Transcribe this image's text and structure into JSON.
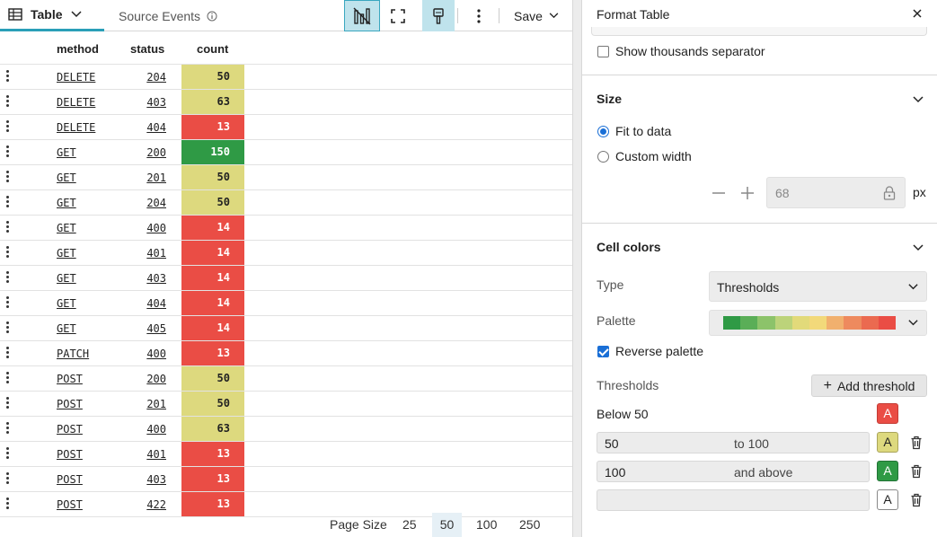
{
  "toolbar": {
    "tab_table": "Table",
    "tab_source": "Source Events",
    "save_label": "Save"
  },
  "table": {
    "columns": [
      "method",
      "status",
      "count"
    ],
    "rows": [
      {
        "method": "DELETE",
        "status": "204",
        "count": "50",
        "color": "yellow"
      },
      {
        "method": "DELETE",
        "status": "403",
        "count": "63",
        "color": "yellow"
      },
      {
        "method": "DELETE",
        "status": "404",
        "count": "13",
        "color": "red"
      },
      {
        "method": "GET",
        "status": "200",
        "count": "150",
        "color": "green"
      },
      {
        "method": "GET",
        "status": "201",
        "count": "50",
        "color": "yellow"
      },
      {
        "method": "GET",
        "status": "204",
        "count": "50",
        "color": "yellow"
      },
      {
        "method": "GET",
        "status": "400",
        "count": "14",
        "color": "red"
      },
      {
        "method": "GET",
        "status": "401",
        "count": "14",
        "color": "red"
      },
      {
        "method": "GET",
        "status": "403",
        "count": "14",
        "color": "red"
      },
      {
        "method": "GET",
        "status": "404",
        "count": "14",
        "color": "red"
      },
      {
        "method": "GET",
        "status": "405",
        "count": "14",
        "color": "red"
      },
      {
        "method": "PATCH",
        "status": "400",
        "count": "13",
        "color": "red"
      },
      {
        "method": "POST",
        "status": "200",
        "count": "50",
        "color": "yellow"
      },
      {
        "method": "POST",
        "status": "201",
        "count": "50",
        "color": "yellow"
      },
      {
        "method": "POST",
        "status": "400",
        "count": "63",
        "color": "yellow"
      },
      {
        "method": "POST",
        "status": "401",
        "count": "13",
        "color": "red"
      },
      {
        "method": "POST",
        "status": "403",
        "count": "13",
        "color": "red"
      },
      {
        "method": "POST",
        "status": "422",
        "count": "13",
        "color": "red"
      }
    ]
  },
  "pager": {
    "label": "Page Size",
    "options": [
      "25",
      "50",
      "100",
      "250"
    ],
    "selected": "50"
  },
  "panel": {
    "title": "Format Table",
    "thousands_label": "Show thousands separator",
    "thousands_checked": false,
    "size": {
      "title": "Size",
      "fit_label": "Fit to data",
      "custom_label": "Custom width",
      "selected": "fit",
      "width_placeholder": "68",
      "unit": "px"
    },
    "cell_colors": {
      "title": "Cell colors",
      "type_label": "Type",
      "type_value": "Thresholds",
      "palette_label": "Palette",
      "palette_colors": [
        "#2f9a45",
        "#5aae57",
        "#8cc36a",
        "#bcd37a",
        "#e2da7a",
        "#f2d97a",
        "#f1b06e",
        "#ee8a5e",
        "#eb6a50",
        "#ea4d45"
      ],
      "reverse_label": "Reverse palette",
      "reverse_checked": true,
      "thresholds_label": "Thresholds",
      "add_threshold_label": "Add threshold",
      "below_label": "Below 50",
      "swatch_letter": "A",
      "thresholds": [
        {
          "value": "50",
          "suffix": "to 100",
          "color": "yellow"
        },
        {
          "value": "100",
          "suffix": "and above",
          "color": "green"
        },
        {
          "value": "",
          "suffix": "",
          "color": "white"
        }
      ]
    }
  },
  "colors": {
    "accent": "#2a9fb8",
    "red": "#ea4d45",
    "yellow": "#ddd97e",
    "green": "#2f9a45",
    "checkbox_blue": "#1a6fd6"
  },
  "icons": {
    "table_tab": "table-grid-icon",
    "source_info": "info-circle-icon",
    "chart_toggle": "column-chart-icon",
    "expand": "fullscreen-icon",
    "format": "paint-brush-icon",
    "more": "vertical-dots-icon",
    "close": "close-icon",
    "lock": "lock-icon",
    "trash": "trash-icon"
  }
}
